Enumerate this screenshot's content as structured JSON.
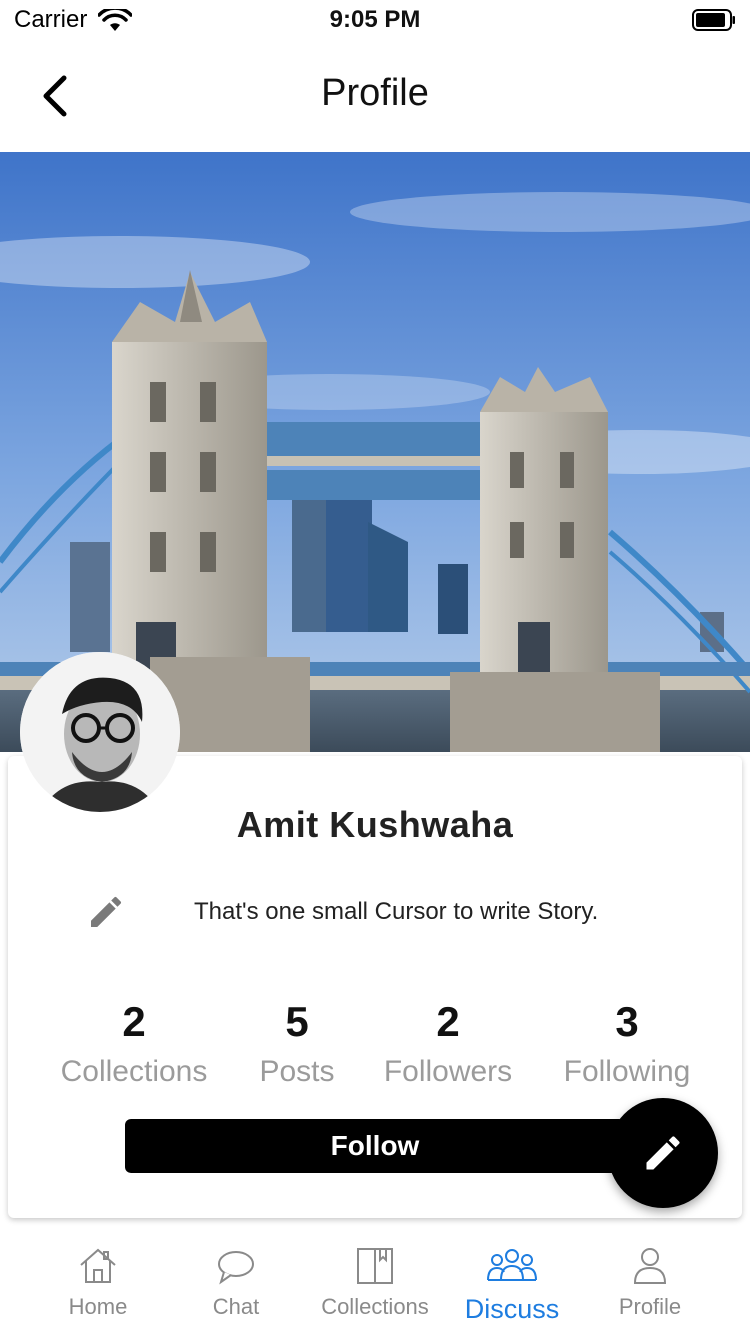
{
  "status_bar": {
    "carrier": "Carrier",
    "time": "9:05 PM"
  },
  "nav": {
    "title": "Profile"
  },
  "profile": {
    "name": "Amit Kushwaha",
    "bio": "That's one small Cursor to write Story.",
    "stats": [
      {
        "value": "2",
        "label": "Collections"
      },
      {
        "value": "5",
        "label": "Posts"
      },
      {
        "value": "2",
        "label": "Followers"
      },
      {
        "value": "3",
        "label": "Following"
      }
    ],
    "follow_label": "Follow"
  },
  "tabs": [
    {
      "label": "Home",
      "icon": "home-icon"
    },
    {
      "label": "Chat",
      "icon": "chat-bubble-icon"
    },
    {
      "label": "Collections",
      "icon": "book-icon"
    },
    {
      "label": "Discuss",
      "icon": "group-icon",
      "active": true
    },
    {
      "label": "Profile",
      "icon": "person-icon"
    }
  ],
  "colors": {
    "accent": "#1e7de0",
    "inactive": "#8a8a8a",
    "button": "#000000"
  }
}
